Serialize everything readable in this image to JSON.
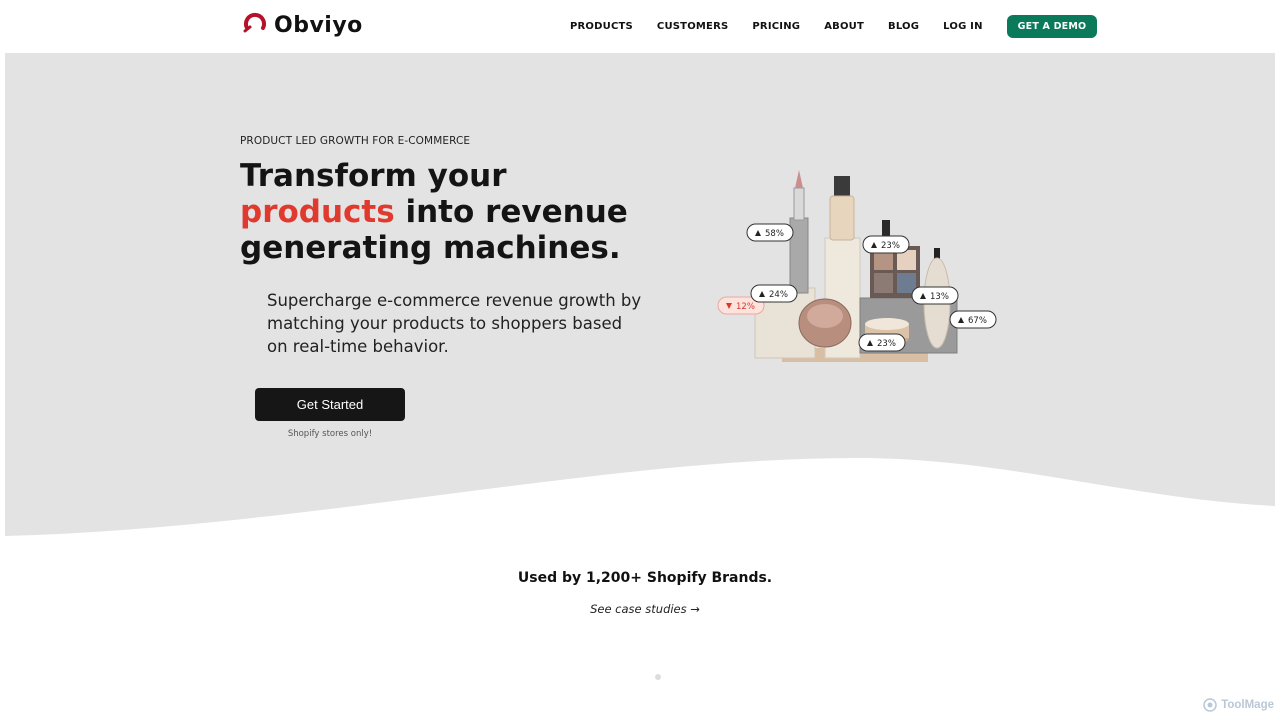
{
  "brand": {
    "name": "Obviyo",
    "accent": "#e03a2f",
    "logo_mark_color": "#b3122a",
    "demo_color": "#0a7a5a"
  },
  "nav": {
    "items": [
      "PRODUCTS",
      "CUSTOMERS",
      "PRICING",
      "ABOUT",
      "BLOG",
      "LOG IN"
    ],
    "demo_label": "GET A DEMO"
  },
  "hero": {
    "eyebrow": "PRODUCT LED GROWTH FOR E-COMMERCE",
    "headline": {
      "line1": "Transform your",
      "accent": "products",
      "rest2": " into revenue",
      "line3": "generating machines."
    },
    "subhead": "Supercharge e-commerce revenue growth by matching your products to shoppers based on real-time behavior.",
    "cta_label": "Get Started",
    "cta_note": "Shopify stores only!",
    "badges": [
      {
        "text": "58%",
        "dir": "up"
      },
      {
        "text": "23%",
        "dir": "up"
      },
      {
        "text": "12%",
        "dir": "down"
      },
      {
        "text": "67%",
        "dir": "up"
      },
      {
        "text": "23%",
        "dir": "up"
      },
      {
        "text": "24%",
        "dir": "up"
      },
      {
        "text": "13%",
        "dir": "up"
      }
    ]
  },
  "social_proof": {
    "brands": "Used by 1,200+ Shopify Brands.",
    "case_link": "See case studies →"
  },
  "watermark": "ToolMage"
}
